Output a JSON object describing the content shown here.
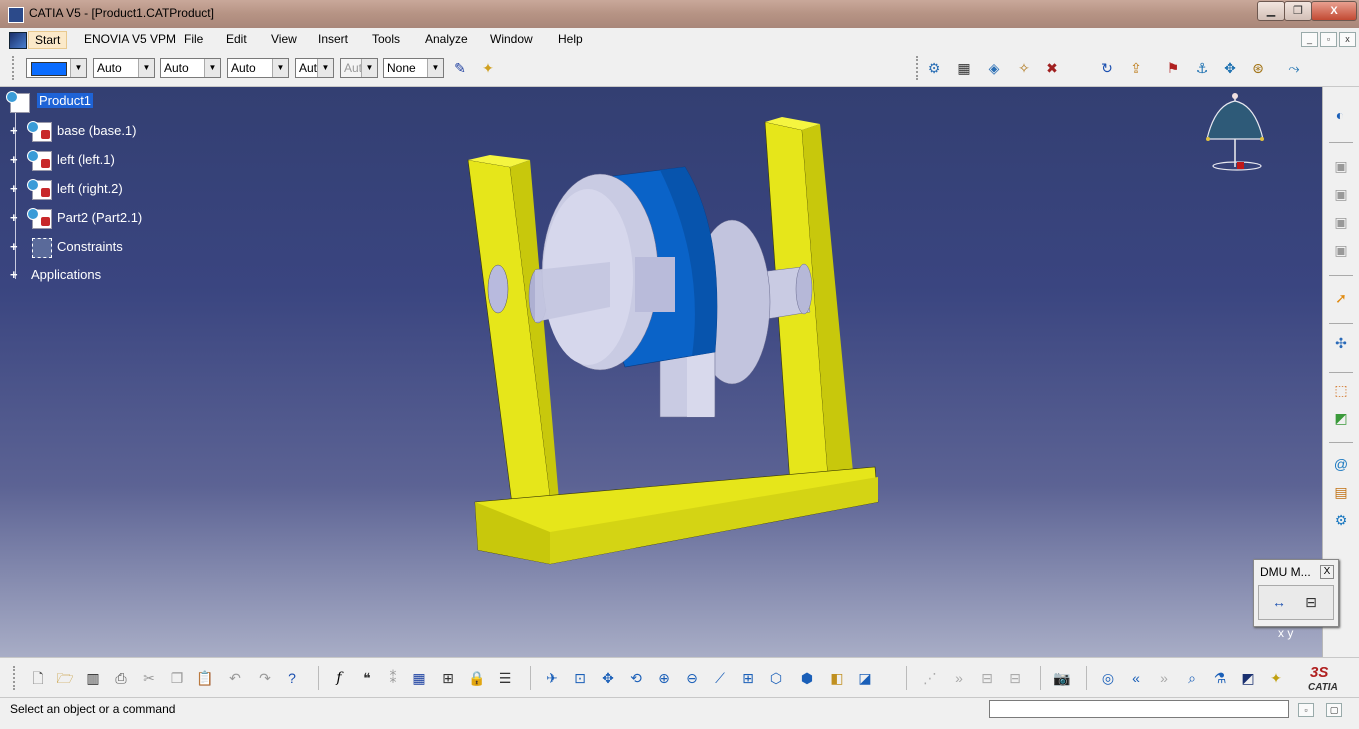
{
  "window": {
    "title": "CATIA V5 - [Product1.CATProduct]",
    "minimize_glyph": "▁",
    "restore_glyph": "❐",
    "close_glyph": "X"
  },
  "menu": {
    "items": [
      "Start",
      "ENOVIA V5 VPM",
      "File",
      "Edit",
      "View",
      "Insert",
      "Tools",
      "Analyze",
      "Window",
      "Help"
    ]
  },
  "properties_toolbar": {
    "color_swatch": "#0a6cff",
    "line_type": "Auto",
    "line_thickness": "Auto",
    "point_symbol": "Auto",
    "layer": "Aut",
    "layer_disabled": "Aut",
    "rendering": "None"
  },
  "tree": {
    "root": "Product1",
    "items": [
      {
        "label": "base (base.1)",
        "icon": "part-icon"
      },
      {
        "label": "left (left.1)",
        "icon": "part-icon"
      },
      {
        "label": "left (right.2)",
        "icon": "part-icon"
      },
      {
        "label": "Part2 (Part2.1)",
        "icon": "part-icon"
      },
      {
        "label": "Constraints",
        "icon": "constraints-icon"
      },
      {
        "label": "Applications",
        "icon": "applications-icon"
      }
    ]
  },
  "compass_axes": "x y",
  "dmu_panel": {
    "title": "DMU M...",
    "close_glyph": "X"
  },
  "status": {
    "message": "Select an object or a command",
    "command_input": ""
  },
  "brand": "CATIA",
  "colors": {
    "viewport_top": "#333f72",
    "model_yellow": "#e8e81a",
    "model_blue": "#0a63c8",
    "model_grey": "#c9cbe3"
  }
}
